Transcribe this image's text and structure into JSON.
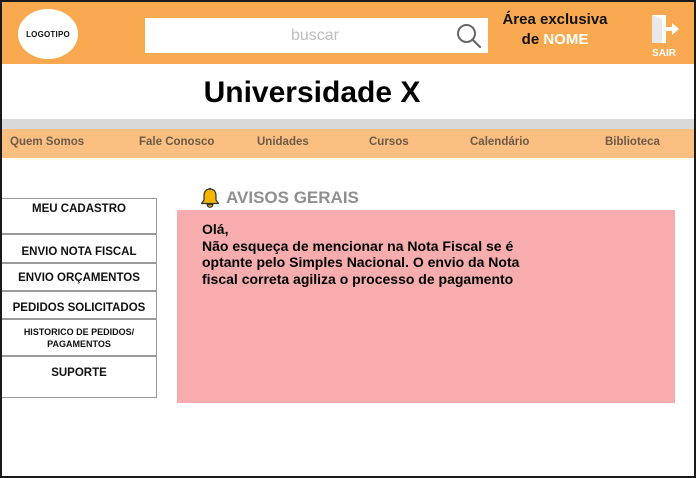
{
  "header": {
    "logo_text": "LOGOTIPO",
    "search_placeholder": "buscar",
    "exclusive_line1": "Área exclusiva",
    "exclusive_prefix": "de",
    "exclusive_name": "NOME",
    "exit_label": "SAIR"
  },
  "page_title": "Universidade X",
  "nav": {
    "items": [
      "Quem Somos",
      "Fale Conosco",
      "Unidades",
      "Cursos",
      "Calendário",
      "Biblioteca"
    ]
  },
  "sidebar": {
    "items": [
      "MEU CADASTRO",
      "ENVIO NOTA FISCAL",
      "ENVIO ORÇAMENTOS",
      "PEDIDOS SOLICITADOS",
      "HISTORICO DE PEDIDOS/",
      "PAGAMENTOS",
      "SUPORTE"
    ]
  },
  "notice": {
    "title": "AVISOS GERAIS",
    "lines": [
      "Olá,",
      "Não esqueça de mencionar na Nota Fiscal se é",
      "optante pelo Simples Nacional. O  envio da Nota",
      "fiscal correta agiliza o processo de pagamento"
    ]
  },
  "colors": {
    "header_bg": "#f9a94f",
    "nav_bg": "#fbbf82",
    "notice_bg": "#f7adad",
    "bell": "#f5b400"
  },
  "icons": {
    "search": "search-icon",
    "exit": "exit-door-icon",
    "bell": "bell-icon"
  }
}
